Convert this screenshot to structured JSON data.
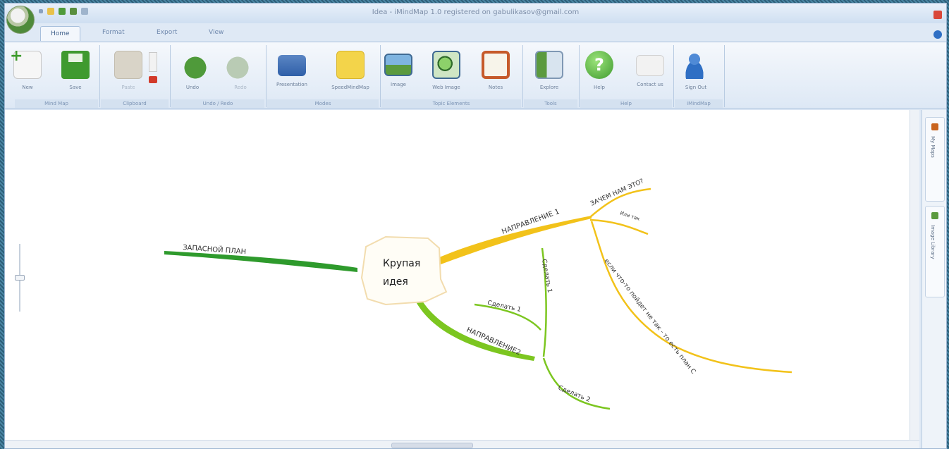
{
  "window": {
    "title": "Idea - iMindMap 1.0 registered on gabulikasov@gmail.com"
  },
  "tabs": [
    {
      "label": "Home",
      "active": true
    },
    {
      "label": "Format",
      "active": false
    },
    {
      "label": "Export",
      "active": false
    },
    {
      "label": "View",
      "active": false
    }
  ],
  "ribbon": {
    "buttons": [
      {
        "label": "New",
        "icon": "new-map-icon"
      },
      {
        "label": "Save",
        "icon": "save-icon"
      },
      {
        "label": "Paste",
        "icon": "paste-icon"
      },
      {
        "label": "Undo",
        "icon": "undo-icon"
      },
      {
        "label": "Redo",
        "icon": "redo-icon"
      },
      {
        "label": "Presentation",
        "icon": "presentation-icon"
      },
      {
        "label": "SpeedMindMap",
        "icon": "speed-map-icon"
      },
      {
        "label": "Image",
        "icon": "image-icon"
      },
      {
        "label": "Web Image",
        "icon": "web-image-icon"
      },
      {
        "label": "Notes",
        "icon": "notes-icon"
      },
      {
        "label": "Explore",
        "icon": "explore-icon"
      },
      {
        "label": "Help",
        "icon": "help-icon"
      },
      {
        "label": "Contact us",
        "icon": "mail-icon"
      },
      {
        "label": "Sign Out",
        "icon": "user-icon"
      }
    ],
    "groups": [
      {
        "label": "Mind Map"
      },
      {
        "label": "Clipboard"
      },
      {
        "label": "Undo / Redo"
      },
      {
        "label": "Modes"
      },
      {
        "label": "Topic Elements"
      },
      {
        "label": "Tools"
      },
      {
        "label": "Help"
      },
      {
        "label": "iMindMap"
      }
    ]
  },
  "side_panel": {
    "tabs": [
      {
        "label": "My Maps",
        "icon": "my-maps-icon"
      },
      {
        "label": "Image Library",
        "icon": "image-library-icon"
      }
    ]
  },
  "mindmap": {
    "central": {
      "line1": "Крупая",
      "line2": "идея"
    },
    "branches": [
      {
        "label": "ЗАПАСНОЙ ПЛАН",
        "color": "#2e9a2c"
      },
      {
        "label": "НАПРАВЛЕНИЕ 1",
        "color": "#f2c21a"
      },
      {
        "label": "НАПРАВЛЕНИЕ2",
        "color": "#7cc620"
      }
    ],
    "sub_branches": [
      {
        "label": "ЗАЧЕМ НАМ ЭТО?"
      },
      {
        "label": "Или так"
      },
      {
        "label": "если что-то пойдет не так - то есть план С"
      },
      {
        "label": "Сделать 1"
      },
      {
        "label": "Сделать 1"
      },
      {
        "label": "Сделать 2"
      }
    ]
  },
  "colors": {
    "ribbon_accent": "#a7bfdc",
    "branch_green": "#2e9a2c",
    "branch_yellow": "#f2c21a",
    "branch_lime": "#7cc620"
  }
}
